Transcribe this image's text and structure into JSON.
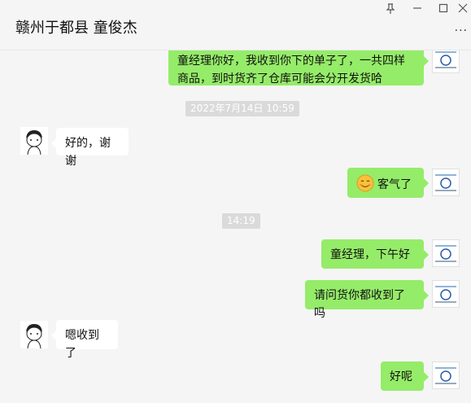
{
  "window": {
    "title": "赣州于都县 童俊杰",
    "pin_icon": "pin-icon",
    "minimize_icon": "minimize-icon",
    "maximize_icon": "maximize-icon",
    "close_icon": "close-icon",
    "more_icon": "more-icon"
  },
  "messages": [
    {
      "from": "me",
      "text": "童经理你好，我收到你下的单子了，一共四样商品，到时货齐了仓库可能会分开发货哈"
    },
    {
      "type": "time",
      "text": "2022年7月14日 10:59"
    },
    {
      "from": "other",
      "text": "好的，谢谢"
    },
    {
      "from": "me",
      "emoji": "smile-emoji",
      "text": "客气了"
    },
    {
      "type": "time",
      "text": "14:19"
    },
    {
      "from": "me",
      "text": "童经理，下午好"
    },
    {
      "from": "me",
      "text": "请问货你都收到了吗"
    },
    {
      "from": "other",
      "text": "嗯收到了"
    },
    {
      "from": "me",
      "text": "好呢"
    }
  ],
  "colors": {
    "my_bubble": "#95ec69",
    "other_bubble": "#ffffff",
    "background": "#f5f5f5",
    "timestamp_bg": "#dadada"
  }
}
